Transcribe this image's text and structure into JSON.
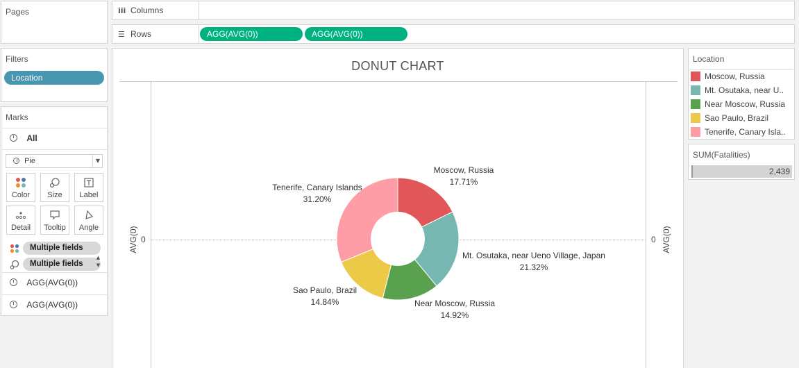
{
  "pages": {
    "title": "Pages"
  },
  "shelves": {
    "columns_label": "Columns",
    "rows_label": "Rows",
    "rows_pills": [
      "AGG(AVG(0))",
      "AGG(AVG(0))"
    ]
  },
  "filters": {
    "title": "Filters",
    "pills": [
      "Location"
    ]
  },
  "marks": {
    "title": "Marks",
    "all_label": "All",
    "mark_type": "Pie",
    "buttons": [
      "Color",
      "Size",
      "Label",
      "Detail",
      "Tooltip",
      "Angle"
    ],
    "field_pills": [
      "Multiple fields",
      "Multiple fields"
    ],
    "cards": [
      "AGG(AVG(0))",
      "AGG(AVG(0))"
    ]
  },
  "view": {
    "title": "DONUT CHART",
    "left_axis_title": "AVG(0)",
    "right_axis_title": "AVG(0)",
    "left_tick": "0",
    "right_tick": "0"
  },
  "legend": {
    "title": "Location",
    "items": [
      {
        "label": "Moscow, Russia",
        "color": "#e15759"
      },
      {
        "label": "Mt. Osutaka, near U..",
        "color": "#76b7b2"
      },
      {
        "label": "Near Moscow, Russia",
        "color": "#59a14f"
      },
      {
        "label": "Sao Paulo, Brazil",
        "color": "#edc948"
      },
      {
        "label": "Tenerife, Canary Isla..",
        "color": "#ff9da7"
      }
    ]
  },
  "size_legend": {
    "title": "SUM(Fatalities)",
    "value": "2,439"
  },
  "colors": {
    "pill_green": "#00b180",
    "pill_blue": "#4996b2",
    "pill_gray": "#d8d8d8"
  },
  "chart_data": {
    "type": "pie",
    "title": "DONUT CHART",
    "categories": [
      "Moscow, Russia",
      "Mt. Osutaka, near Ueno Village, Japan",
      "Near Moscow, Russia",
      "Sao Paulo, Brazil",
      "Tenerife, Canary Islands"
    ],
    "values": [
      17.71,
      21.32,
      14.92,
      14.84,
      31.2
    ],
    "labels": [
      "17.71%",
      "21.32%",
      "14.92%",
      "14.84%",
      "31.20%"
    ],
    "colors": [
      "#e15759",
      "#76b7b2",
      "#59a14f",
      "#edc948",
      "#ff9da7"
    ],
    "unit": "%",
    "donut": true
  }
}
